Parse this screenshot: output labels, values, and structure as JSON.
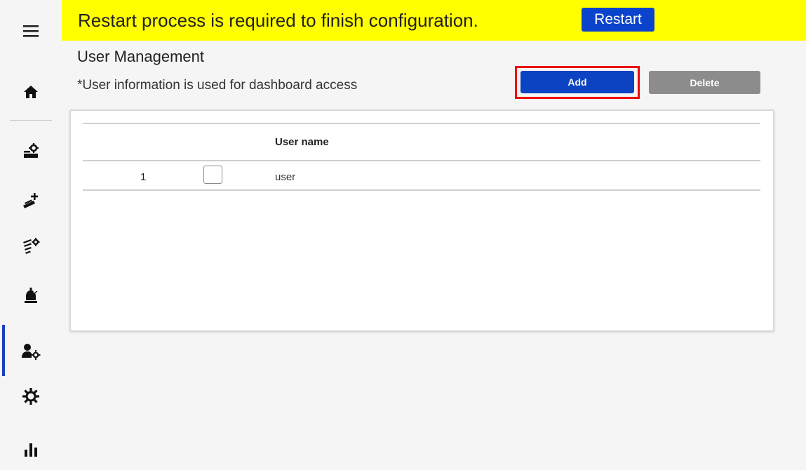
{
  "banner": {
    "message": "Restart process is required to finish configuration.",
    "restart_label": "Restart",
    "background_color": "#ffff00"
  },
  "sidebar": {
    "items": [
      {
        "name": "menu",
        "icon": "hamburger-menu-icon"
      },
      {
        "name": "home",
        "icon": "home-icon"
      },
      {
        "name": "device-settings",
        "icon": "device-settings-icon"
      },
      {
        "name": "add-camera",
        "icon": "add-camera-icon"
      },
      {
        "name": "camera-settings",
        "icon": "camera-group-settings-icon"
      },
      {
        "name": "alarm",
        "icon": "alarm-icon"
      },
      {
        "name": "user-management",
        "icon": "user-settings-icon",
        "active": true
      },
      {
        "name": "settings",
        "icon": "gear-icon"
      },
      {
        "name": "statistics",
        "icon": "bar-chart-icon"
      }
    ],
    "active_color": "#1d3fbf"
  },
  "page": {
    "title": "User Management",
    "subtitle": "*User information is used for dashboard access"
  },
  "toolbar": {
    "add_label": "Add",
    "delete_label": "Delete",
    "add_color": "#0b43c2",
    "delete_color": "#8c8c8c",
    "highlight_color": "#ee0000"
  },
  "table": {
    "columns": [
      "",
      "",
      "User name"
    ],
    "rows": [
      {
        "index": "1",
        "checked": false,
        "user_name": "user"
      }
    ]
  }
}
